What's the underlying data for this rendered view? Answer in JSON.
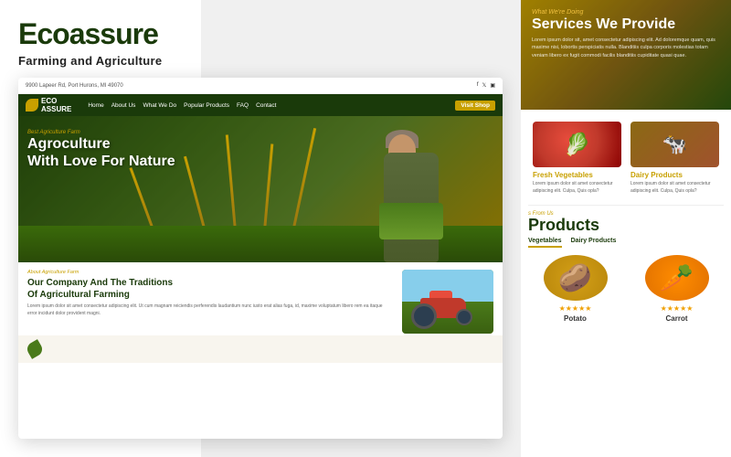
{
  "brand": {
    "title": "Ecoassure",
    "subtitle": "Farming and Agriculture"
  },
  "services": {
    "small_label": "What We're Doing",
    "title": "Services We Provide",
    "description": "Lorem ipsum dolor sit, amet consectetur adipiscing elit. Ad doloremque quam, quis maxime nisi, lobortis perspiciatis nulla. Blanditiis culpa corporis molestias totam veniam libero ex fugit commodi facilis blanditiis cupiditate quasi quae."
  },
  "products_cards": [
    {
      "title": "Fresh Vegetables",
      "text": "Lorem ipsum dolor sit amet consectetur adipiscing elit. Culpa, Quis opla?"
    },
    {
      "title": "Dairy Products",
      "text": "Lorem ipsum dolor sit amet consectetur adipiscing elit. Culpa, Quis opla?"
    }
  ],
  "products_section": {
    "small_label": "s From Us",
    "title": "Products",
    "tabs": [
      "Vegetables",
      "Dairy Products"
    ]
  },
  "product_items": [
    {
      "name": "Potato",
      "stars": "★★★★★"
    },
    {
      "name": "Carrot",
      "stars": "★★★★★"
    }
  ],
  "site": {
    "topbar": {
      "address": "9900 Lapeer Rd, Port Hurons, MI 49070"
    },
    "nav_links": [
      "Home",
      "About Us",
      "What We Do",
      "Popular Products",
      "FAQ",
      "Contact"
    ],
    "visit_btn": "Visit Shop",
    "hero": {
      "small": "Best Agriculture Farm",
      "title_line1": "Agroculture",
      "title_line2": "With Love For Nature"
    },
    "about": {
      "small": "About Agriculture Farm",
      "title_line1": "Our Company And The Traditions",
      "title_line2": "Of Agricultural Farming",
      "text": "Lorem ipsum dolor sit amet consectetur adipiscing elit. Ut cum magnam reiciendis perferendis laudantium nunc iusto erat alias fuga, id, maxime voluptatum libero rem ea itaque error incidunt dolor provident magni."
    }
  }
}
